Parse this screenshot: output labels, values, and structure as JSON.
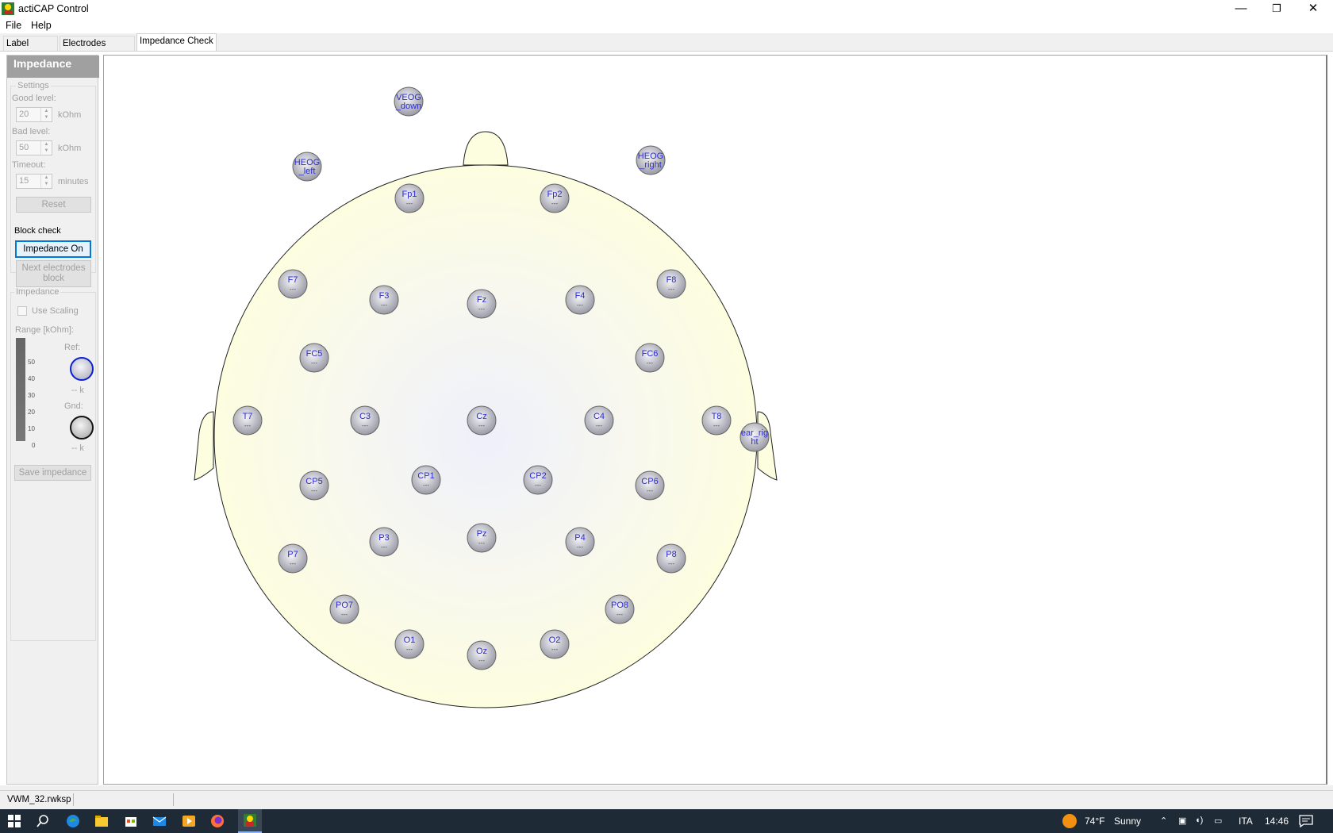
{
  "window": {
    "title": "actiCAP Control",
    "minimize": "—",
    "restore": "❐",
    "close": "✕"
  },
  "menu": {
    "items": [
      "File",
      "Help"
    ]
  },
  "tabs": [
    "Label Check",
    "Electrodes Groups",
    "Impedance Check"
  ],
  "panel": {
    "title": "Impedance",
    "settings_label": "Settings",
    "good_level_label": "Good level:",
    "good_level_value": "20",
    "bad_level_label": "Bad level:",
    "bad_level_value": "50",
    "timeout_label": "Timeout:",
    "timeout_value": "15",
    "unit_kohm": "kOhm",
    "unit_minutes": "minutes",
    "reset_label": "Reset",
    "block_check_label": "Block check",
    "impedance_on_label": "Impedance On",
    "next_block_label": "Next electrodes block",
    "impedance_group_label": "Impedance",
    "use_scaling_label": "Use Scaling",
    "range_label": "Range [kOhm]:",
    "range_ticks": [
      "50",
      "40",
      "30",
      "20",
      "10",
      "0"
    ],
    "ref_label": "Ref:",
    "ref_value": "-- k",
    "gnd_label": "Gnd:",
    "gnd_value": "-- k",
    "save_label": "Save impedance"
  },
  "electrodes": [
    {
      "name": "VEOG_down",
      "line1": "VEOG",
      "line2": "_down",
      "value": ""
    },
    {
      "name": "HEOG_left",
      "line1": "HEOG",
      "line2": "_left",
      "value": ""
    },
    {
      "name": "HEOG_right",
      "line1": "HEOG",
      "line2": "_right",
      "value": ""
    },
    {
      "name": "Fp1",
      "line1": "Fp1",
      "line2": "---",
      "value": "---"
    },
    {
      "name": "Fp2",
      "line1": "Fp2",
      "line2": "---",
      "value": "---"
    },
    {
      "name": "F7",
      "line1": "F7",
      "line2": "---",
      "value": "---"
    },
    {
      "name": "F3",
      "line1": "F3",
      "line2": "---",
      "value": "---"
    },
    {
      "name": "Fz",
      "line1": "Fz",
      "line2": "---",
      "value": "---"
    },
    {
      "name": "F4",
      "line1": "F4",
      "line2": "---",
      "value": "---"
    },
    {
      "name": "F8",
      "line1": "F8",
      "line2": "---",
      "value": "---"
    },
    {
      "name": "FC5",
      "line1": "FC5",
      "line2": "---",
      "value": "---"
    },
    {
      "name": "FC6",
      "line1": "FC6",
      "line2": "---",
      "value": "---"
    },
    {
      "name": "T7",
      "line1": "T7",
      "line2": "---",
      "value": "---"
    },
    {
      "name": "C3",
      "line1": "C3",
      "line2": "---",
      "value": "---"
    },
    {
      "name": "Cz",
      "line1": "Cz",
      "line2": "---",
      "value": "---"
    },
    {
      "name": "C4",
      "line1": "C4",
      "line2": "---",
      "value": "---"
    },
    {
      "name": "T8",
      "line1": "T8",
      "line2": "---",
      "value": "---"
    },
    {
      "name": "ear_right",
      "line1": "ear_rig",
      "line2": "ht",
      "value": ""
    },
    {
      "name": "CP5",
      "line1": "CP5",
      "line2": "---",
      "value": "---"
    },
    {
      "name": "CP1",
      "line1": "CP1",
      "line2": "---",
      "value": "---"
    },
    {
      "name": "CP2",
      "line1": "CP2",
      "line2": "---",
      "value": "---"
    },
    {
      "name": "CP6",
      "line1": "CP6",
      "line2": "---",
      "value": "---"
    },
    {
      "name": "P7",
      "line1": "P7",
      "line2": "---",
      "value": "---"
    },
    {
      "name": "P3",
      "line1": "P3",
      "line2": "---",
      "value": "---"
    },
    {
      "name": "Pz",
      "line1": "Pz",
      "line2": "---",
      "value": "---"
    },
    {
      "name": "P4",
      "line1": "P4",
      "line2": "---",
      "value": "---"
    },
    {
      "name": "P8",
      "line1": "P8",
      "line2": "---",
      "value": "---"
    },
    {
      "name": "PO7",
      "line1": "PO7",
      "line2": "---",
      "value": "---"
    },
    {
      "name": "PO8",
      "line1": "PO8",
      "line2": "---",
      "value": "---"
    },
    {
      "name": "O1",
      "line1": "O1",
      "line2": "---",
      "value": "---"
    },
    {
      "name": "Oz",
      "line1": "Oz",
      "line2": "---",
      "value": "---"
    },
    {
      "name": "O2",
      "line1": "O2",
      "line2": "---",
      "value": "---"
    }
  ],
  "status": {
    "file": "VWM_32.rwksp"
  },
  "taskbar": {
    "weather_temp": "74°F",
    "weather_text": "Sunny",
    "language": "ITA",
    "time": "14:46",
    "icons": [
      "windows-start-icon",
      "search-icon",
      "edge-icon",
      "file-explorer-icon",
      "store-icon",
      "mail-icon",
      "media-player-icon",
      "firefox-icon",
      "acticap-icon"
    ]
  },
  "colors": {
    "head_fill": "#fdfde0",
    "electrode_label": "#2b2bd4",
    "accent": "#0078d7"
  }
}
